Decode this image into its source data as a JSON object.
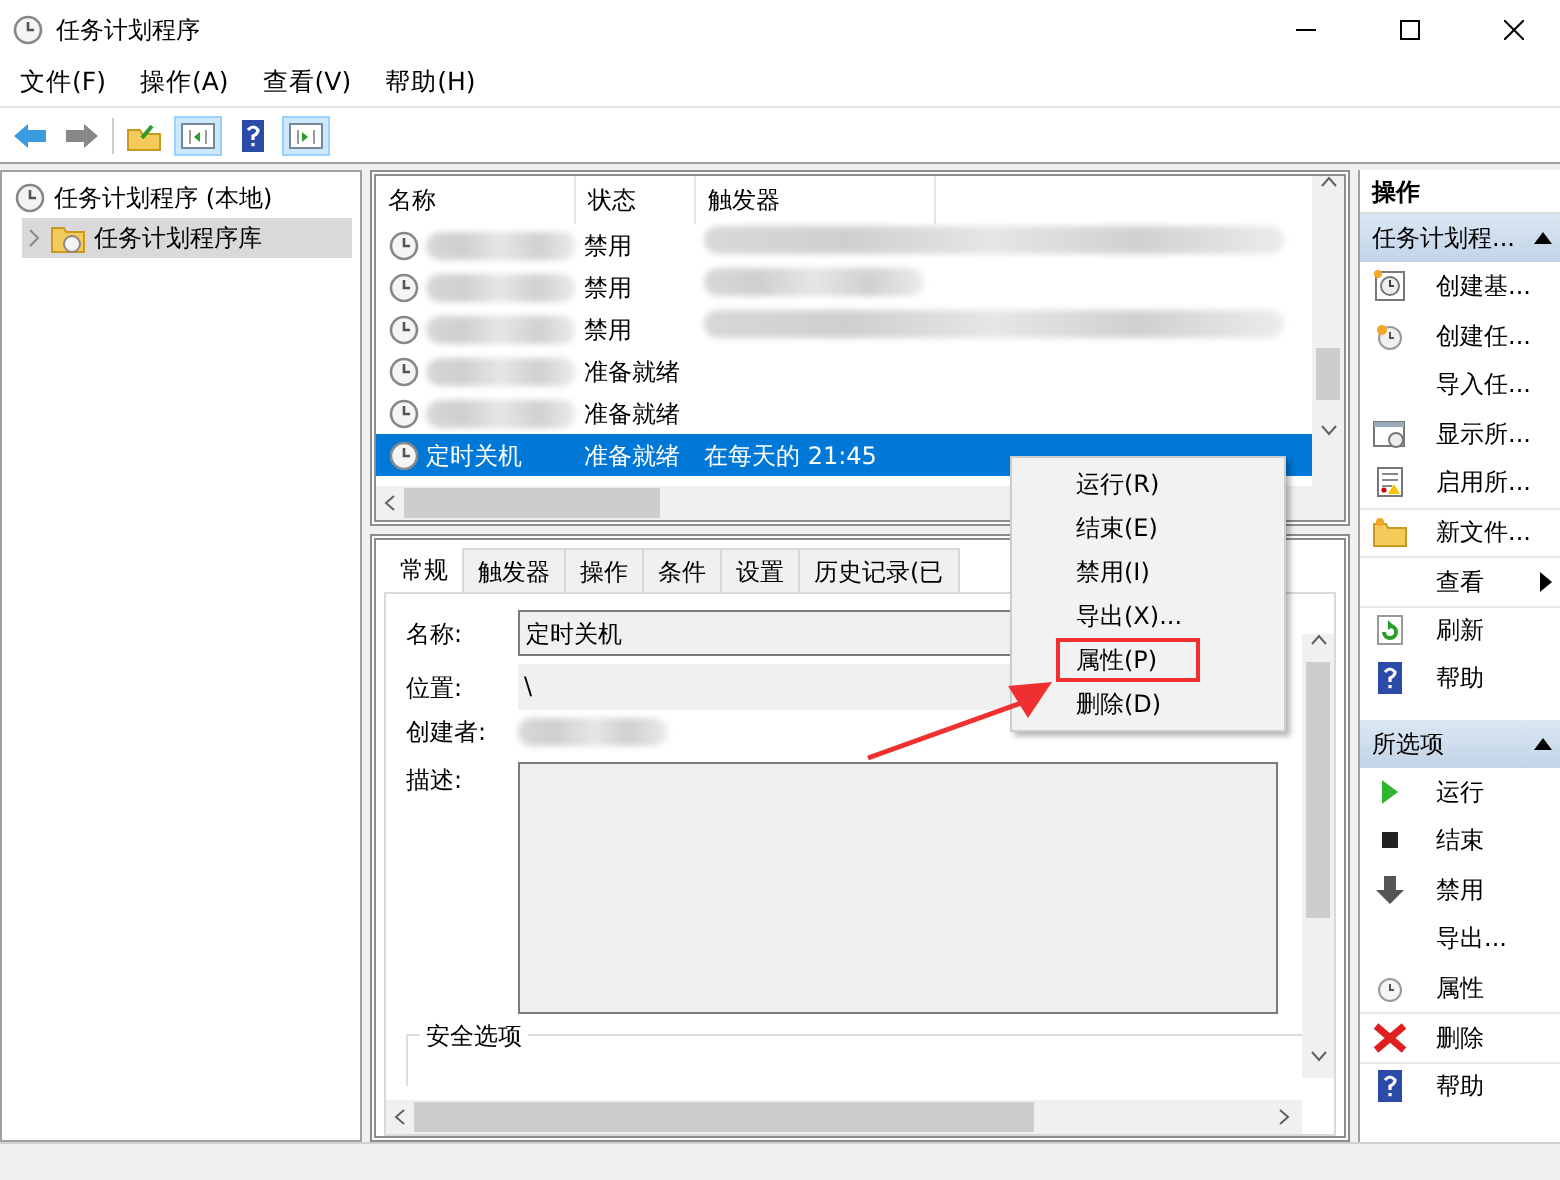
{
  "window": {
    "title": "任务计划程序"
  },
  "menu": [
    "文件(F)",
    "操作(A)",
    "查看(V)",
    "帮助(H)"
  ],
  "tree": [
    {
      "label": "任务计划程序 (本地)",
      "selected": false,
      "children": [
        {
          "label": "任务计划程序库",
          "selected": true,
          "expanded": false
        }
      ]
    }
  ],
  "task_list": {
    "columns": [
      "名称",
      "状态",
      "触发器"
    ],
    "rows": [
      {
        "name_redacted": true,
        "status": "禁用",
        "trigger_redacted": true,
        "selected": false
      },
      {
        "name_redacted": true,
        "status": "禁用",
        "trigger_redacted": true,
        "selected": false
      },
      {
        "name_redacted": true,
        "status": "禁用",
        "trigger_redacted": true,
        "selected": false
      },
      {
        "name_redacted": true,
        "status": "准备就绪",
        "selected": false
      },
      {
        "name_redacted": true,
        "status": "准备就绪",
        "selected": false
      },
      {
        "name": "定时关机",
        "status": "准备就绪",
        "trigger": "在每天的 21:45",
        "selected": true
      }
    ]
  },
  "details": {
    "tabs": [
      {
        "label": "常规",
        "selected": true
      },
      {
        "label": "触发器",
        "selected": false
      },
      {
        "label": "操作",
        "selected": false
      },
      {
        "label": "条件",
        "selected": false
      },
      {
        "label": "设置",
        "selected": false
      },
      {
        "label": "历史记录(已",
        "selected": false
      }
    ],
    "name_label": "名称:",
    "name_value": "定时关机",
    "location_label": "位置:",
    "location_value": "\\",
    "author_label": "创建者:",
    "author_redacted": true,
    "description_label": "描述:",
    "security_group": "安全选项"
  },
  "context_menu": [
    {
      "label": "运行(R)",
      "annotated": false
    },
    {
      "label": "结束(E)",
      "annotated": false
    },
    {
      "label": "禁用(I)",
      "annotated": false
    },
    {
      "label": "导出(X)...",
      "annotated": false
    },
    {
      "label": "属性(P)",
      "annotated": true
    },
    {
      "label": "删除(D)",
      "annotated": false
    }
  ],
  "actions": {
    "title": "操作",
    "sections": [
      {
        "title": "任务计划程...",
        "expanded": true,
        "items": [
          {
            "label": "创建基...",
            "kind": "clockdoc",
            "divider": false
          },
          {
            "label": "创建任...",
            "kind": "clockstar",
            "divider": false
          },
          {
            "label": "导入任...",
            "kind": "plain",
            "divider": false
          },
          {
            "label": "显示所...",
            "kind": "windowclock",
            "divider": false
          },
          {
            "label": "启用所...",
            "kind": "document",
            "divider": false
          },
          {
            "label": "新文件...",
            "kind": "folder",
            "divider": true
          },
          {
            "label": "查看",
            "kind": "plain",
            "submenu": true,
            "divider": true
          },
          {
            "label": "刷新",
            "kind": "refresh",
            "divider": true
          },
          {
            "label": "帮助",
            "kind": "help",
            "divider": false
          }
        ]
      },
      {
        "title": "所选项",
        "expanded": true,
        "items": [
          {
            "label": "运行",
            "kind": "run",
            "divider": false
          },
          {
            "label": "结束",
            "kind": "stop",
            "divider": false
          },
          {
            "label": "禁用",
            "kind": "disable",
            "divider": false
          },
          {
            "label": "导出...",
            "kind": "plain",
            "divider": false
          },
          {
            "label": "属性",
            "kind": "clock",
            "divider": false
          },
          {
            "label": "删除",
            "kind": "delete",
            "divider": true
          },
          {
            "label": "帮助",
            "kind": "help",
            "divider": true
          }
        ]
      }
    ]
  }
}
